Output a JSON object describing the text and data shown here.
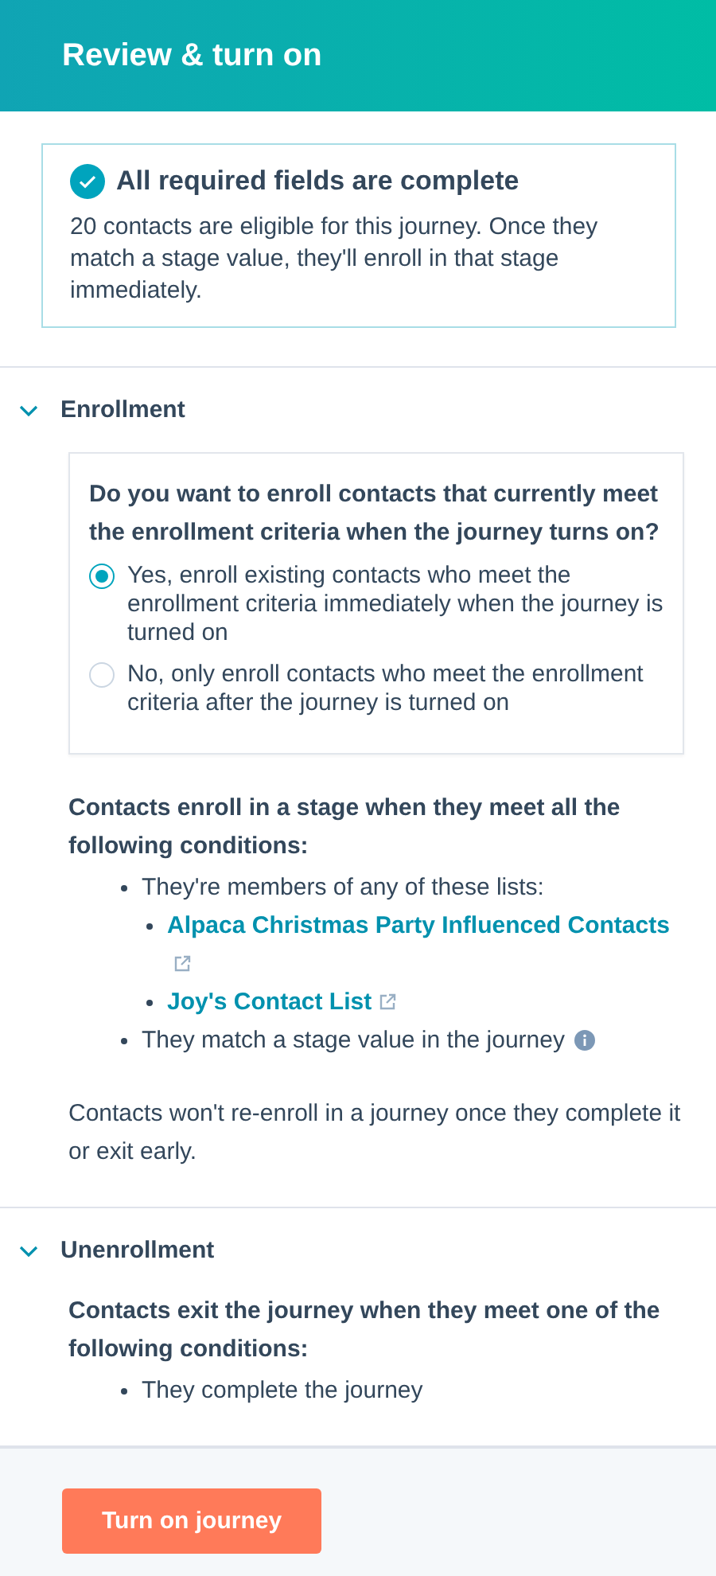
{
  "header": {
    "title": "Review & turn on"
  },
  "status": {
    "complete": true,
    "title": "All required fields are complete",
    "text": "20 contacts are eligible for this journey. Once they match a stage value, they'll enroll in that stage immediately."
  },
  "sections": [
    {
      "title": "Enrollment",
      "expanded": true,
      "question": {
        "title": "Do you want to enroll contacts that currently meet the enrollment criteria when the journey turns on?",
        "options": [
          {
            "label": "Yes, enroll existing contacts who meet the enrollment criteria immediately when the journey is turned on",
            "selected": true
          },
          {
            "label": "No, only enroll contacts who meet the enrollment criteria after the journey is turned on",
            "selected": false
          }
        ]
      },
      "conditions_title": "Contacts enroll in a stage when they meet all the following conditions:",
      "conditions": [
        {
          "kind": "text",
          "text": "They're members of any of these lists:",
          "info_icon": false,
          "children": [
            {
              "kind": "link",
              "text": "Alpaca Christmas Party Influenced Contacts",
              "info_icon": false
            },
            {
              "kind": "link",
              "text": "Joy's Contact List",
              "info_icon": false
            }
          ]
        },
        {
          "kind": "text",
          "text": "They match a stage value in the journey",
          "info_icon": true
        }
      ],
      "note": "Contacts won't re-enroll in a journey once they complete it or exit early."
    },
    {
      "title": "Unenrollment",
      "expanded": true,
      "conditions_title": "Contacts exit the journey when they meet one of the following conditions:",
      "conditions": [
        {
          "kind": "text",
          "text": "They complete the journey",
          "info_icon": false
        }
      ]
    }
  ],
  "footer": {
    "button": "Turn on journey"
  }
}
